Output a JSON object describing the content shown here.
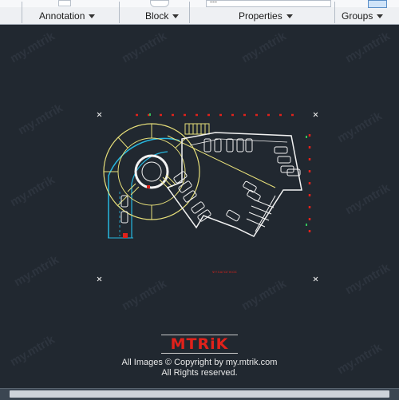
{
  "ribbon": {
    "panels": [
      {
        "label": "Annotation"
      },
      {
        "label": "Block"
      },
      {
        "label": "Properties"
      },
      {
        "label": "Groups"
      }
    ],
    "field_value": "---"
  },
  "drawing": {
    "plan_label": "ΨΥΧΑΓΩΓΙΚΟΣ"
  },
  "watermark": {
    "brand": "MTRiK",
    "copyright": "All Images © Copyright by my.mtrik.com",
    "rights": "All Rights reserved."
  },
  "colors": {
    "canvas": "#212830",
    "accent_red": "#e0221b",
    "line_yellow": "#e8e07a",
    "line_white": "#f2f2f2",
    "line_cyan": "#27b8e0"
  }
}
